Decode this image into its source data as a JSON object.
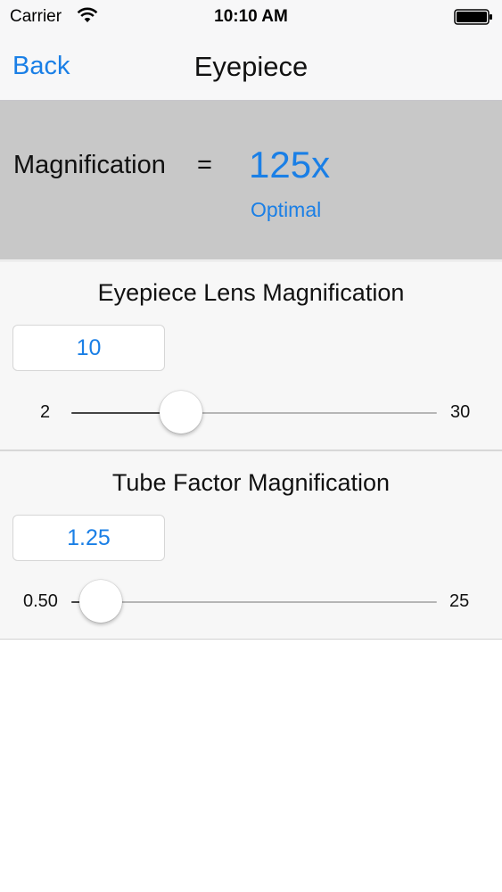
{
  "status_bar": {
    "carrier": "Carrier",
    "time": "10:10 AM",
    "wifi_icon": "wifi-icon",
    "battery_icon": "battery-icon"
  },
  "nav": {
    "back_label": "Back",
    "title": "Eyepiece"
  },
  "result": {
    "label": "Magnification",
    "equals": "=",
    "value": "125x",
    "status": "Optimal"
  },
  "eyepiece": {
    "title": "Eyepiece Lens Magnification",
    "value": "10",
    "min_label": "2",
    "max_label": "30",
    "slider_fraction": 0.3
  },
  "tube": {
    "title": "Tube Factor Magnification",
    "value": "1.25",
    "min_label": "0.50",
    "max_label": "25",
    "slider_fraction": 0.08
  },
  "colors": {
    "accent": "#1a7fe6",
    "result_panel_bg": "#c8c8c8",
    "section_bg": "#f7f7f7"
  }
}
